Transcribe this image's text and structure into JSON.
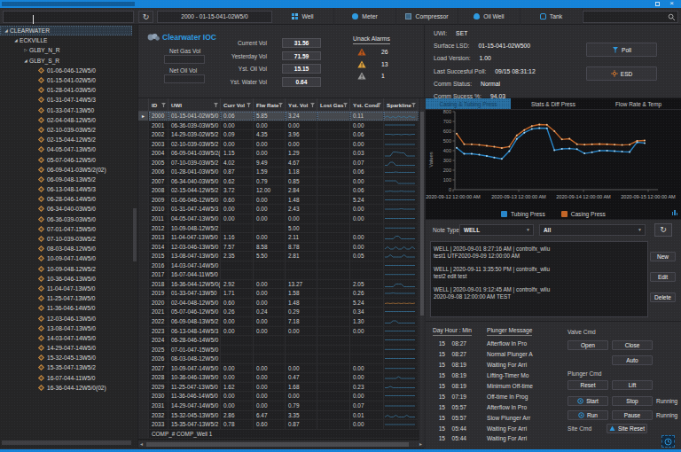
{
  "window": {
    "restore_icon": "restore",
    "close_icon": "×"
  },
  "toolbar": {
    "refresh_icon": "↻",
    "selector_value": "2000 - 01-15-041-02W5/0",
    "tabs": [
      {
        "label": "Well",
        "icon": "well-grid-icon"
      },
      {
        "label": "Meter",
        "icon": "meter-icon"
      },
      {
        "label": "Compressor",
        "icon": "compressor-icon"
      },
      {
        "label": "Oil Well",
        "icon": "oil-well-icon"
      },
      {
        "label": "Tank",
        "icon": "tank-icon"
      }
    ]
  },
  "tree": {
    "root": "CLEARWATER",
    "area": "ECKVILLE",
    "group_collapsed": "GLBY_N_R",
    "group_expanded": "GLBY_S_R",
    "wells": [
      "01-06-046-12W5/0",
      "01-15-041-02W5/0",
      "01-28-041-03W5/0",
      "01-31-047-14W5/3",
      "01-33-047-13W50",
      "02-04-048-12W5/0",
      "02-10-039-03W5/2",
      "02-15-044-12W5/2",
      "04-05-047-13W5/0",
      "05-07-046-12W5/0",
      "06-09-041-03W5/2(02)",
      "06-09-048-13W5/2",
      "06-13-048-14W5/3",
      "06-28-046-14W5/0",
      "06-34-040-03W5/0",
      "06-36-039-03W5/0",
      "07-01-047-15W5/0",
      "07-10-039-03W5/2",
      "08-03-048-12W5/0",
      "10-09-047-14W5/0",
      "10-09-048-12W5/2",
      "10-36-046-13W5/0",
      "11-04-047-13W5/0",
      "11-25-047-13W5/0",
      "11-36-046-14W5/0",
      "12-03-046-13W5/0",
      "13-08-047-13W5/0",
      "14-03-047-14W5/0",
      "14-29-047-14W5/0",
      "15-32-045-13W5/0",
      "15-35-047-13W5/2",
      "16-07-044-11W5/0",
      "16-36-044-12W5/0(02)"
    ]
  },
  "summary": {
    "brand": "Clearwater IOC",
    "net_gas_label": "Net Gas Vol",
    "net_oil_label": "Net Oil Vol",
    "stats": [
      {
        "label": "Current Vol",
        "value": "31.56"
      },
      {
        "label": "Yesterday Vol",
        "value": "71.59"
      },
      {
        "label": "Yst. Oil Vol",
        "value": "15.15"
      },
      {
        "label": "Yst. Water Vol",
        "value": "0.64"
      }
    ],
    "alarms": {
      "title": "Unack Alarms",
      "items": [
        {
          "count": "26",
          "color": "#bb5519"
        },
        {
          "count": "13",
          "color": "#dfa23b"
        },
        {
          "count": "1",
          "color": "#9a9a9a"
        }
      ]
    }
  },
  "well_info": {
    "rows": [
      {
        "label": "UWI:",
        "value": "SET"
      },
      {
        "label": "Surface LSD:",
        "value": "01-15-041-02W500"
      },
      {
        "label": "Load Version:",
        "value": "1.00"
      },
      {
        "label": "Last Succesful Poll:",
        "value": "09/15 08:31:12"
      },
      {
        "label": "Comm Status:",
        "value": "Normal"
      },
      {
        "label": "Comm Sucess %:",
        "value": "94.03"
      }
    ],
    "poll_label": "Poll",
    "esd_label": "ESD"
  },
  "grid": {
    "columns": [
      "ID",
      "UWI",
      "Curr Vol",
      "Flw Rate",
      "Yst. Vol",
      "Lost Gas",
      "Yst. Cond",
      "Sparkline"
    ],
    "selected_id": "2000",
    "rows": [
      {
        "id": "2000",
        "uwi": "01-15-041-02W5/0",
        "curr": "0.06",
        "flw": "5.85",
        "yst": "3.24",
        "lost": "",
        "cond": "0.11",
        "spark": [
          5,
          3.5,
          5.5,
          4,
          5.5,
          3.5,
          5,
          4,
          5.5,
          3.5,
          5,
          4.5
        ]
      },
      {
        "id": "2001",
        "uwi": "06-36-039-03W5/0",
        "curr": "0.00",
        "flw": "0.00",
        "yst": "0.00",
        "lost": "",
        "cond": "0.00",
        "spark": [
          2.5,
          2.5,
          2.5,
          2.5,
          2.5,
          2.5,
          2.5,
          2.5,
          2.5,
          2.5,
          2.5,
          2.5
        ]
      },
      {
        "id": "2002",
        "uwi": "14-29-039-02W5/2",
        "curr": "0.09",
        "flw": "4.35",
        "yst": "3.96",
        "lost": "",
        "cond": "0.06",
        "spark": [
          3,
          3,
          3,
          3.5,
          3,
          3,
          3.5,
          3,
          3,
          3.5,
          3,
          3
        ]
      },
      {
        "id": "2003",
        "uwi": "02-10-039-03W5/2",
        "curr": "0.00",
        "flw": "0.00",
        "yst": "0.00",
        "lost": "",
        "cond": "0.00",
        "spark": [
          3.5,
          3.5,
          3.5,
          3.5,
          3.5,
          3.5,
          3.5,
          3.5,
          3.5,
          3.5,
          3.5,
          3.5
        ]
      },
      {
        "id": "2004",
        "uwi": "06-09-041-03W5/2(02)",
        "curr": "1.15",
        "flw": "0.00",
        "yst": "1.29",
        "lost": "",
        "cond": "0.03",
        "spark": [
          6.5,
          6.5,
          6.5,
          2,
          2,
          2.5,
          3,
          3,
          6.5,
          6.5,
          6.5,
          6.5
        ]
      },
      {
        "id": "2005",
        "uwi": "07-10-039-03W5/2",
        "curr": "4.02",
        "flw": "9.49",
        "yst": "4.67",
        "lost": "",
        "cond": "0.07",
        "spark": [
          6,
          6,
          2.5,
          2.5,
          6,
          6,
          6,
          6,
          6,
          6,
          6,
          6
        ]
      },
      {
        "id": "2006",
        "uwi": "01-28-041-03W5/0",
        "curr": "0.87",
        "flw": "1.59",
        "yst": "1.18",
        "lost": "",
        "cond": "0.06",
        "spark": [
          4,
          4,
          4,
          4,
          3.5,
          4,
          4,
          4,
          4,
          4,
          4,
          4
        ]
      },
      {
        "id": "2007",
        "uwi": "06-34-040-03W5/0",
        "curr": "0.62",
        "flw": "0.79",
        "yst": "0.85",
        "lost": "",
        "cond": "0.00",
        "spark": [
          2.5,
          2.5,
          2.5,
          2.5,
          2.5,
          5.5,
          5.5,
          5.5,
          5.5,
          5.5,
          5.5,
          5.5
        ]
      },
      {
        "id": "2008",
        "uwi": "02-15-044-12W5/2",
        "curr": "3.72",
        "flw": "12.00",
        "yst": "2.84",
        "lost": "",
        "cond": "0.06",
        "spark": [
          4.5,
          4.5,
          4,
          4.5,
          4.5,
          4.5,
          4,
          4.5,
          4.5,
          4.5,
          4.5,
          4.5
        ]
      },
      {
        "id": "2009",
        "uwi": "01-06-046-12W5/0",
        "curr": "0.60",
        "flw": "0.00",
        "yst": "1.48",
        "lost": "",
        "cond": "5.24",
        "spark": [
          3,
          3,
          3,
          3,
          3,
          3,
          3,
          3,
          3,
          3,
          3,
          3
        ]
      },
      {
        "id": "2010",
        "uwi": "01-31-047-14W5/3",
        "curr": "0.00",
        "flw": "0.00",
        "yst": "2.43",
        "lost": "",
        "cond": "0.00",
        "spark": [
          3.5,
          3.5,
          3.5,
          3.5,
          3.5,
          3.5,
          3,
          3.5,
          3.5,
          3.5,
          3.5,
          3.5
        ]
      },
      {
        "id": "2011",
        "uwi": "04-05-047-13W5/0",
        "curr": "0.00",
        "flw": "0.00",
        "yst": "0.00",
        "lost": "",
        "cond": "0.00",
        "spark": [
          3,
          3,
          3,
          3,
          3,
          3,
          3,
          3,
          3,
          3,
          3,
          3
        ]
      },
      {
        "id": "2012",
        "uwi": "10-09-048-12W5/2",
        "curr": "",
        "flw": "",
        "yst": "5.00",
        "lost": "",
        "cond": "",
        "spark": [
          2.8,
          2.8,
          2.8,
          2.8,
          2.8,
          2.8,
          2.8,
          2.8,
          2.8,
          2.8,
          2.8,
          2.8
        ]
      },
      {
        "id": "2013",
        "uwi": "11-04-047-13W5/0",
        "curr": "1.16",
        "flw": "0.00",
        "yst": "2.11",
        "lost": "",
        "cond": "0.00",
        "spark": [
          5,
          5,
          5,
          5,
          2,
          2,
          5,
          5,
          5,
          5,
          5,
          5
        ]
      },
      {
        "id": "2014",
        "uwi": "12-03-046-13W5/0",
        "curr": "7.57",
        "flw": "8.58",
        "yst": "8.78",
        "lost": "",
        "cond": "0.00",
        "spark": [
          5.5,
          3,
          5.5,
          5.5,
          3,
          5.5,
          5.5,
          3,
          5.5,
          5.5,
          3,
          5.5
        ]
      },
      {
        "id": "2015",
        "uwi": "13-08-047-13W5/0",
        "curr": "2.35",
        "flw": "5.50",
        "yst": "2.81",
        "lost": "",
        "cond": "0.05",
        "spark": [
          4.5,
          4.5,
          2,
          4.5,
          4.5,
          4.5,
          4.5,
          2,
          4.5,
          4.5,
          4.5,
          4.5
        ]
      },
      {
        "id": "2016",
        "uwi": "14-03-047-14W5/0",
        "curr": "",
        "flw": "",
        "yst": "",
        "lost": "",
        "cond": "",
        "spark": [
          3,
          3,
          3,
          3,
          3,
          3,
          3,
          3,
          3,
          3,
          3,
          3
        ]
      },
      {
        "id": "2017",
        "uwi": "16-07-044-11W5/0",
        "curr": "",
        "flw": "",
        "yst": "",
        "lost": "",
        "cond": "",
        "spark": [
          3.2,
          3.2,
          3.2,
          3.2,
          3.2,
          3.2,
          3.2,
          3.2,
          3.2,
          3.2,
          3.2,
          3.2
        ]
      },
      {
        "id": "2018",
        "uwi": "16-36-044-12W5/0(02)",
        "curr": "2.92",
        "flw": "0.00",
        "yst": "13.27",
        "lost": "",
        "cond": "2.05",
        "spark": [
          6,
          6,
          6,
          6,
          3,
          3,
          3,
          6,
          6,
          6,
          6,
          6
        ]
      },
      {
        "id": "2019",
        "uwi": "01-33-047-13W50",
        "curr": "1.71",
        "flw": "0.00",
        "yst": "1.58",
        "lost": "",
        "cond": "0.26",
        "spark": [
          3.5,
          3.5,
          3.5,
          3,
          3.5,
          3.5,
          3.5,
          3.5,
          3.5,
          3.5,
          3.5,
          3.5
        ]
      },
      {
        "id": "2020",
        "uwi": "02-04-048-12W5/0",
        "curr": "0.60",
        "flw": "0.00",
        "yst": "1.48",
        "lost": "",
        "cond": "5.24",
        "spark": [
          4,
          3.5,
          4,
          3.5,
          4,
          3.5,
          4,
          3.5,
          4,
          3.5,
          4,
          3.5
        ],
        "spark_color": "#b97a3a"
      },
      {
        "id": "2021",
        "uwi": "05-07-046-12W5/0",
        "curr": "0.26",
        "flw": "0.24",
        "yst": "0.29",
        "lost": "",
        "cond": "0.34",
        "spark": [
          3,
          3,
          3,
          3,
          3,
          3,
          3,
          3,
          3,
          3,
          3,
          3
        ]
      },
      {
        "id": "2022",
        "uwi": "06-09-048-13W5/2",
        "curr": "0.00",
        "flw": "0.00",
        "yst": "7.18",
        "lost": "",
        "cond": "1.30",
        "spark": [
          5,
          5,
          5,
          2.5,
          2.5,
          5,
          5,
          5,
          5,
          5,
          5,
          5
        ]
      },
      {
        "id": "2023",
        "uwi": "06-13-048-14W5/3",
        "curr": "0.00",
        "flw": "0.00",
        "yst": "0.00",
        "lost": "",
        "cond": "0.00",
        "spark": [
          3,
          3,
          3,
          3,
          3,
          3,
          3,
          3,
          3,
          3,
          3,
          3
        ]
      },
      {
        "id": "2024",
        "uwi": "06-28-046-14W5/0",
        "curr": "",
        "flw": "",
        "yst": "",
        "lost": "",
        "cond": "",
        "spark": [
          3,
          3,
          3,
          3,
          3,
          3,
          3,
          3,
          3,
          3,
          3,
          3
        ]
      },
      {
        "id": "2025",
        "uwi": "07-01-047-15W5/0",
        "curr": "",
        "flw": "",
        "yst": "",
        "lost": "",
        "cond": "",
        "spark": [
          2.8,
          2.8,
          2.8,
          2.8,
          2.8,
          2.8,
          2.8,
          2.8,
          2.8,
          2.8,
          2.8,
          2.8
        ]
      },
      {
        "id": "2026",
        "uwi": "08-03-048-12W5/0",
        "curr": "",
        "flw": "",
        "yst": "",
        "lost": "",
        "cond": "",
        "spark": [
          3,
          3,
          3,
          3,
          3,
          3,
          3,
          3,
          3,
          3,
          3,
          3
        ]
      },
      {
        "id": "2027",
        "uwi": "10-09-047-14W5/0",
        "curr": "0.00",
        "flw": "0.00",
        "yst": "0.00",
        "lost": "",
        "cond": "0.00",
        "spark": [
          3.2,
          3.2,
          3.2,
          3.2,
          3.2,
          3.2,
          3.2,
          3.2,
          3.2,
          3.2,
          3.2,
          3.2
        ]
      },
      {
        "id": "2028",
        "uwi": "10-36-046-13W5/0",
        "curr": "0.00",
        "flw": "0.00",
        "yst": "0.47",
        "lost": "",
        "cond": "0.00",
        "spark": [
          4.5,
          4.5,
          4.5,
          4.5,
          4.5,
          2.5,
          4.5,
          4.5,
          4.5,
          4.5,
          4.5,
          4.5
        ]
      },
      {
        "id": "2029",
        "uwi": "11-25-047-13W5/0",
        "curr": "1.62",
        "flw": "0.00",
        "yst": "1.68",
        "lost": "",
        "cond": "0.23",
        "spark": [
          4,
          4,
          2.5,
          4,
          4,
          4,
          4,
          4,
          4,
          4,
          4,
          4
        ]
      },
      {
        "id": "2030",
        "uwi": "11-36-046-14W5/0",
        "curr": "0.00",
        "flw": "0.00",
        "yst": "0.00",
        "lost": "",
        "cond": "0.00",
        "spark": [
          3,
          3,
          3,
          3,
          3,
          3,
          3,
          3,
          3,
          3,
          3,
          3
        ]
      },
      {
        "id": "2031",
        "uwi": "14-29-047-14W5/0",
        "curr": "0.00",
        "flw": "0.00",
        "yst": "0.79",
        "lost": "",
        "cond": "0.07",
        "spark": [
          3.5,
          3.5,
          3.5,
          3.5,
          3.5,
          3.5,
          3.5,
          3.5,
          3.5,
          3.5,
          3.5,
          3.5
        ]
      },
      {
        "id": "2032",
        "uwi": "15-32-045-13W5/0",
        "curr": "2.86",
        "flw": "6.47",
        "yst": "3.35",
        "lost": "",
        "cond": "0.01",
        "spark": [
          5,
          3,
          5,
          5,
          3,
          5,
          5,
          5,
          3,
          5,
          5,
          5
        ]
      },
      {
        "id": "2033",
        "uwi": "15-35-047-13W5/2",
        "curr": "0.78",
        "flw": "0.60",
        "yst": "0.87",
        "lost": "",
        "cond": "0.00",
        "spark": [
          3.5,
          3.5,
          3.5,
          3.5,
          3.5,
          3.5,
          3.5,
          3.5,
          3.5,
          3.5,
          3.5,
          3.5
        ]
      }
    ],
    "footer": {
      "id": "COMP_#",
      "uwi": "COMP_Well 1"
    }
  },
  "chart_data": {
    "type": "line",
    "tabs": [
      "Casing & Tubing Press",
      "Stats & Diff Press",
      "Flow Rate & Temp"
    ],
    "active_tab": "Casing & Tubing Press",
    "ylabel": "Values",
    "ylim": [
      0,
      800
    ],
    "yticks": [
      0,
      100,
      200,
      300,
      400,
      500,
      600,
      700,
      800
    ],
    "x_labels": [
      "2020-09-12 12:00:00 AM",
      "2020-09-13 12:00:00 AM",
      "2020-09-14 12:00:00 AM",
      "2020-09-15 12:00:00 AM"
    ],
    "series": [
      {
        "name": "Tubing Press",
        "color": "#2886c9",
        "marker": "#a8d4ef",
        "values": [
          430,
          368,
          368,
          358,
          345,
          330,
          316,
          395,
          520,
          585,
          622,
          632,
          630,
          405,
          418,
          422,
          415,
          372,
          383,
          400,
          400,
          396,
          390,
          386,
          487,
          478
        ]
      },
      {
        "name": "Casing Press",
        "color": "#c36527",
        "marker": "#ecbd8d",
        "values": [
          575,
          467,
          465,
          460,
          450,
          440,
          427,
          442,
          556,
          612,
          652,
          668,
          665,
          600,
          515,
          522,
          467,
          462,
          466,
          468,
          466,
          462,
          458,
          462,
          500,
          505
        ]
      }
    ],
    "legend_position": "bottom"
  },
  "notes": {
    "type_label": "Note Type",
    "type_value": "WELL",
    "filter_value": "All",
    "refresh_icon": "↻",
    "items": [
      {
        "line1": "WELL | 2020-09-01 8:27:16 AM | controlfx_wliu",
        "line2": "test1 UTF2020-09-09 12:00:00 AM"
      },
      {
        "line1": "WELL | 2020-09-11 3:35:50 PM | controlfx_wliu",
        "line2": "test2 edit test"
      },
      {
        "line1": "WELL | 2020-09-01 9:12:45 AM | controlfx_wliu",
        "line2": "2020-09-08 12:00:00 AM TEST"
      }
    ],
    "buttons": [
      "New",
      "Edit",
      "Delete"
    ]
  },
  "plunger_log": {
    "col1": "Day Hour : Min",
    "col2": "Plunger Message",
    "rows": [
      {
        "day": "15",
        "time": "08:27",
        "msg": "Afterflow In Pro"
      },
      {
        "day": "15",
        "time": "08:27",
        "msg": "Normal Plunger A"
      },
      {
        "day": "15",
        "time": "08:19",
        "msg": "Waiting For Arri"
      },
      {
        "day": "15",
        "time": "08:19",
        "msg": "Lifting-Timer Mo"
      },
      {
        "day": "15",
        "time": "08:19",
        "msg": "Minimum Off-time"
      },
      {
        "day": "15",
        "time": "07:19",
        "msg": "Off-time In Prog"
      },
      {
        "day": "15",
        "time": "05:57",
        "msg": "Afterflow In Pro"
      },
      {
        "day": "15",
        "time": "05:57",
        "msg": "Slow Plunger Arr"
      },
      {
        "day": "15",
        "time": "05:44",
        "msg": "Waiting For Arri"
      },
      {
        "day": "15",
        "time": "05:44",
        "msg": "Waiting For Arri"
      }
    ]
  },
  "commands": {
    "valve_label": "Valve Cmd",
    "valve": [
      "Open",
      "Close",
      "Auto"
    ],
    "plunger_label": "Plunger Cmd",
    "plunger": [
      "Reset",
      "Lift",
      "Start",
      "Stop",
      "Run",
      "Pause"
    ],
    "running_label": "Running",
    "site_label": "Site Cmd",
    "site_button": "Site Reset"
  }
}
